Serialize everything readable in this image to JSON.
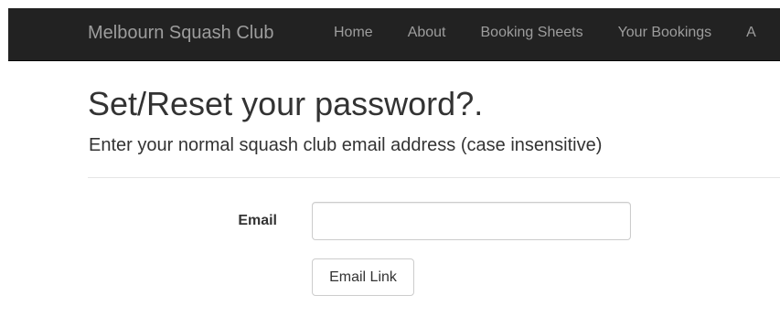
{
  "navbar": {
    "brand": "Melbourn Squash Club",
    "items": [
      {
        "label": "Home"
      },
      {
        "label": "About"
      },
      {
        "label": "Booking Sheets"
      },
      {
        "label": "Your Bookings"
      },
      {
        "label": "A"
      }
    ],
    "background_color": "#222222",
    "text_color": "#9d9d9d"
  },
  "main": {
    "title": "Set/Reset your password?.",
    "subtitle": "Enter your normal squash club email address (case insensitive)",
    "form": {
      "email_label": "Email",
      "email_value": "",
      "email_placeholder": "",
      "submit_label": "Email Link"
    }
  }
}
